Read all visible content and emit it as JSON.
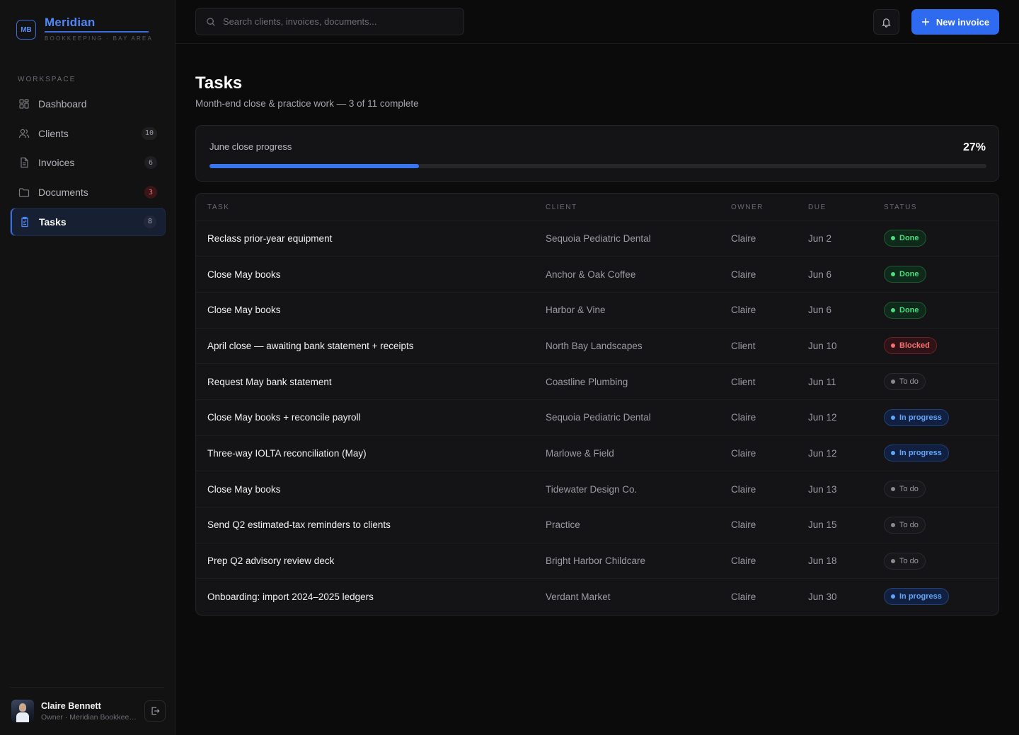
{
  "brand": {
    "logo": "MB",
    "name": "Meridian",
    "subtitle": "BOOKKEEPING · BAY AREA",
    "accent": "#3b6fe0"
  },
  "sidebar": {
    "section_label": "WORKSPACE",
    "items": [
      {
        "label": "Dashboard",
        "icon": "grid-icon",
        "badge": ""
      },
      {
        "label": "Clients",
        "icon": "users-icon",
        "badge": "10"
      },
      {
        "label": "Invoices",
        "icon": "file-icon",
        "badge": "6"
      },
      {
        "label": "Documents",
        "icon": "folder-icon",
        "badge": "3"
      },
      {
        "label": "Tasks",
        "icon": "clipboard-icon",
        "badge": "8",
        "active": true
      }
    ]
  },
  "user": {
    "name": "Claire Bennett",
    "role": "Owner · Meridian Bookkeeping"
  },
  "topbar": {
    "search_placeholder": "Search clients, invoices, documents...",
    "new_button_label": "New invoice"
  },
  "page": {
    "title": "Tasks",
    "subtitle": "Month-end close & practice work — 3 of 11 complete"
  },
  "progress": {
    "label": "June close progress",
    "percent_label": "27%",
    "fraction": 0.27
  },
  "table": {
    "headers": {
      "task": "TASK",
      "client": "CLIENT",
      "owner": "OWNER",
      "due": "DUE",
      "status": "STATUS"
    },
    "rows": [
      {
        "task": "Reclass prior-year equipment",
        "client": "Sequoia Pediatric Dental",
        "owner": "Claire",
        "due": "Jun 2",
        "status": "Done",
        "status_kind": "done"
      },
      {
        "task": "Close May books",
        "client": "Anchor & Oak Coffee",
        "owner": "Claire",
        "due": "Jun 6",
        "status": "Done",
        "status_kind": "done"
      },
      {
        "task": "Close May books",
        "client": "Harbor & Vine",
        "owner": "Claire",
        "due": "Jun 6",
        "status": "Done",
        "status_kind": "done"
      },
      {
        "task": "April close — awaiting bank statement + receipts",
        "client": "North Bay Landscapes",
        "owner": "Client",
        "due": "Jun 10",
        "status": "Blocked",
        "status_kind": "blocked"
      },
      {
        "task": "Request May bank statement",
        "client": "Coastline Plumbing",
        "owner": "Client",
        "due": "Jun 11",
        "status": "To do",
        "status_kind": "todo"
      },
      {
        "task": "Close May books + reconcile payroll",
        "client": "Sequoia Pediatric Dental",
        "owner": "Claire",
        "due": "Jun 12",
        "status": "In progress",
        "status_kind": "progress"
      },
      {
        "task": "Three-way IOLTA reconciliation (May)",
        "client": "Marlowe & Field",
        "owner": "Claire",
        "due": "Jun 12",
        "status": "In progress",
        "status_kind": "progress"
      },
      {
        "task": "Close May books",
        "client": "Tidewater Design Co.",
        "owner": "Claire",
        "due": "Jun 13",
        "status": "To do",
        "status_kind": "todo"
      },
      {
        "task": "Send Q2 estimated-tax reminders to clients",
        "client": "Practice",
        "owner": "Claire",
        "due": "Jun 15",
        "status": "To do",
        "status_kind": "todo"
      },
      {
        "task": "Prep Q2 advisory review deck",
        "client": "Bright Harbor Childcare",
        "owner": "Claire",
        "due": "Jun 18",
        "status": "To do",
        "status_kind": "todo"
      },
      {
        "task": "Onboarding: import 2024–2025 ledgers",
        "client": "Verdant Market",
        "owner": "Claire",
        "due": "Jun 30",
        "status": "In progress",
        "status_kind": "progress"
      }
    ]
  }
}
